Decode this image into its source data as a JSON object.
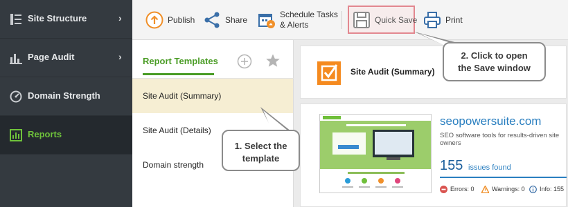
{
  "sidebar": {
    "items": [
      {
        "label": "Site Structure",
        "icon": "site-structure-icon",
        "chevron": "›"
      },
      {
        "label": "Page Audit",
        "icon": "page-audit-icon",
        "chevron": "›"
      },
      {
        "label": "Domain Strength",
        "icon": "gauge-icon",
        "chevron": ""
      },
      {
        "label": "Reports",
        "icon": "reports-icon",
        "chevron": "",
        "active": true
      }
    ]
  },
  "toolbar": {
    "publish": "Publish",
    "share": "Share",
    "schedule_line1": "Schedule Tasks",
    "schedule_line2": "& Alerts",
    "quick_save": "Quick Save",
    "print": "Print"
  },
  "templates": {
    "tab": "Report Templates",
    "items": [
      "Site Audit (Summary)",
      "Site Audit (Details)",
      "Domain strength"
    ],
    "selected_index": 0
  },
  "report": {
    "title": "Site Audit (Summary)",
    "site_name": "seopowersuite.com",
    "site_desc": "SEO software tools for results-driven site owners",
    "issues_count": "155",
    "issues_label": "issues found",
    "errors": "Errors: 0",
    "warnings": "Warnings: 0",
    "info": "Info: 155"
  },
  "callouts": {
    "select_line1": "1. Select the",
    "select_line2": "template",
    "save_line1": "2. Click to open",
    "save_line2": "the Save window"
  },
  "colors": {
    "accent_green": "#4a9c25",
    "sidebar_bg": "#343a40",
    "selected_row": "#f6eed3",
    "link_blue": "#2a7fc0",
    "publish_orange": "#f0902a"
  }
}
